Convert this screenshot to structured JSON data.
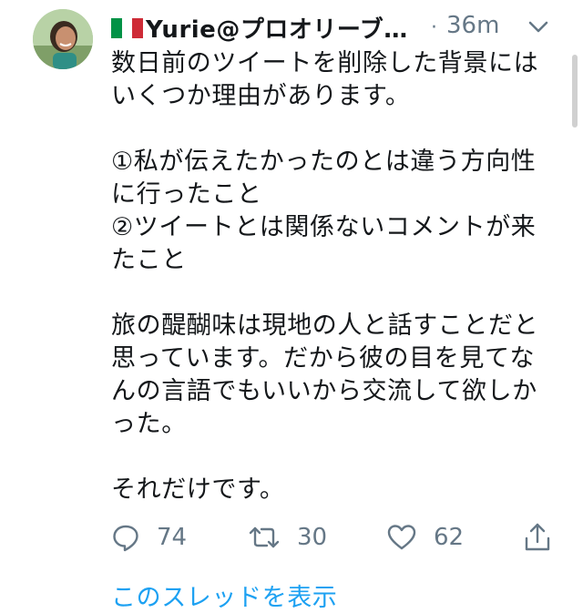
{
  "tweet": {
    "author_name": "Yurie@プロオリーブ…",
    "separator": "·",
    "time": "36m",
    "flag_colors": [
      "#009246",
      "#ffffff",
      "#ce2b37"
    ],
    "body_lines": [
      "数日前のツイートを削除した背景には",
      "いくつか理由があります。",
      "",
      "①私が伝えたかったのとは違う方向性",
      "に行ったこと",
      "②ツイートとは関係ないコメントが来",
      "たこと",
      "",
      "旅の醍醐味は現地の人と話すことだと",
      "思っています。だから彼の目を見てな",
      "んの言語でもいいから交流して欲しか",
      "った。",
      "",
      "それだけです。"
    ],
    "actions": {
      "reply_icon": "reply-icon",
      "reply_count": "74",
      "retweet_icon": "retweet-icon",
      "retweet_count": "30",
      "like_icon": "heart-icon",
      "like_count": "62",
      "share_icon": "share-icon"
    },
    "show_thread_label": "このスレッドを表示",
    "link_color": "#1da1f2"
  }
}
